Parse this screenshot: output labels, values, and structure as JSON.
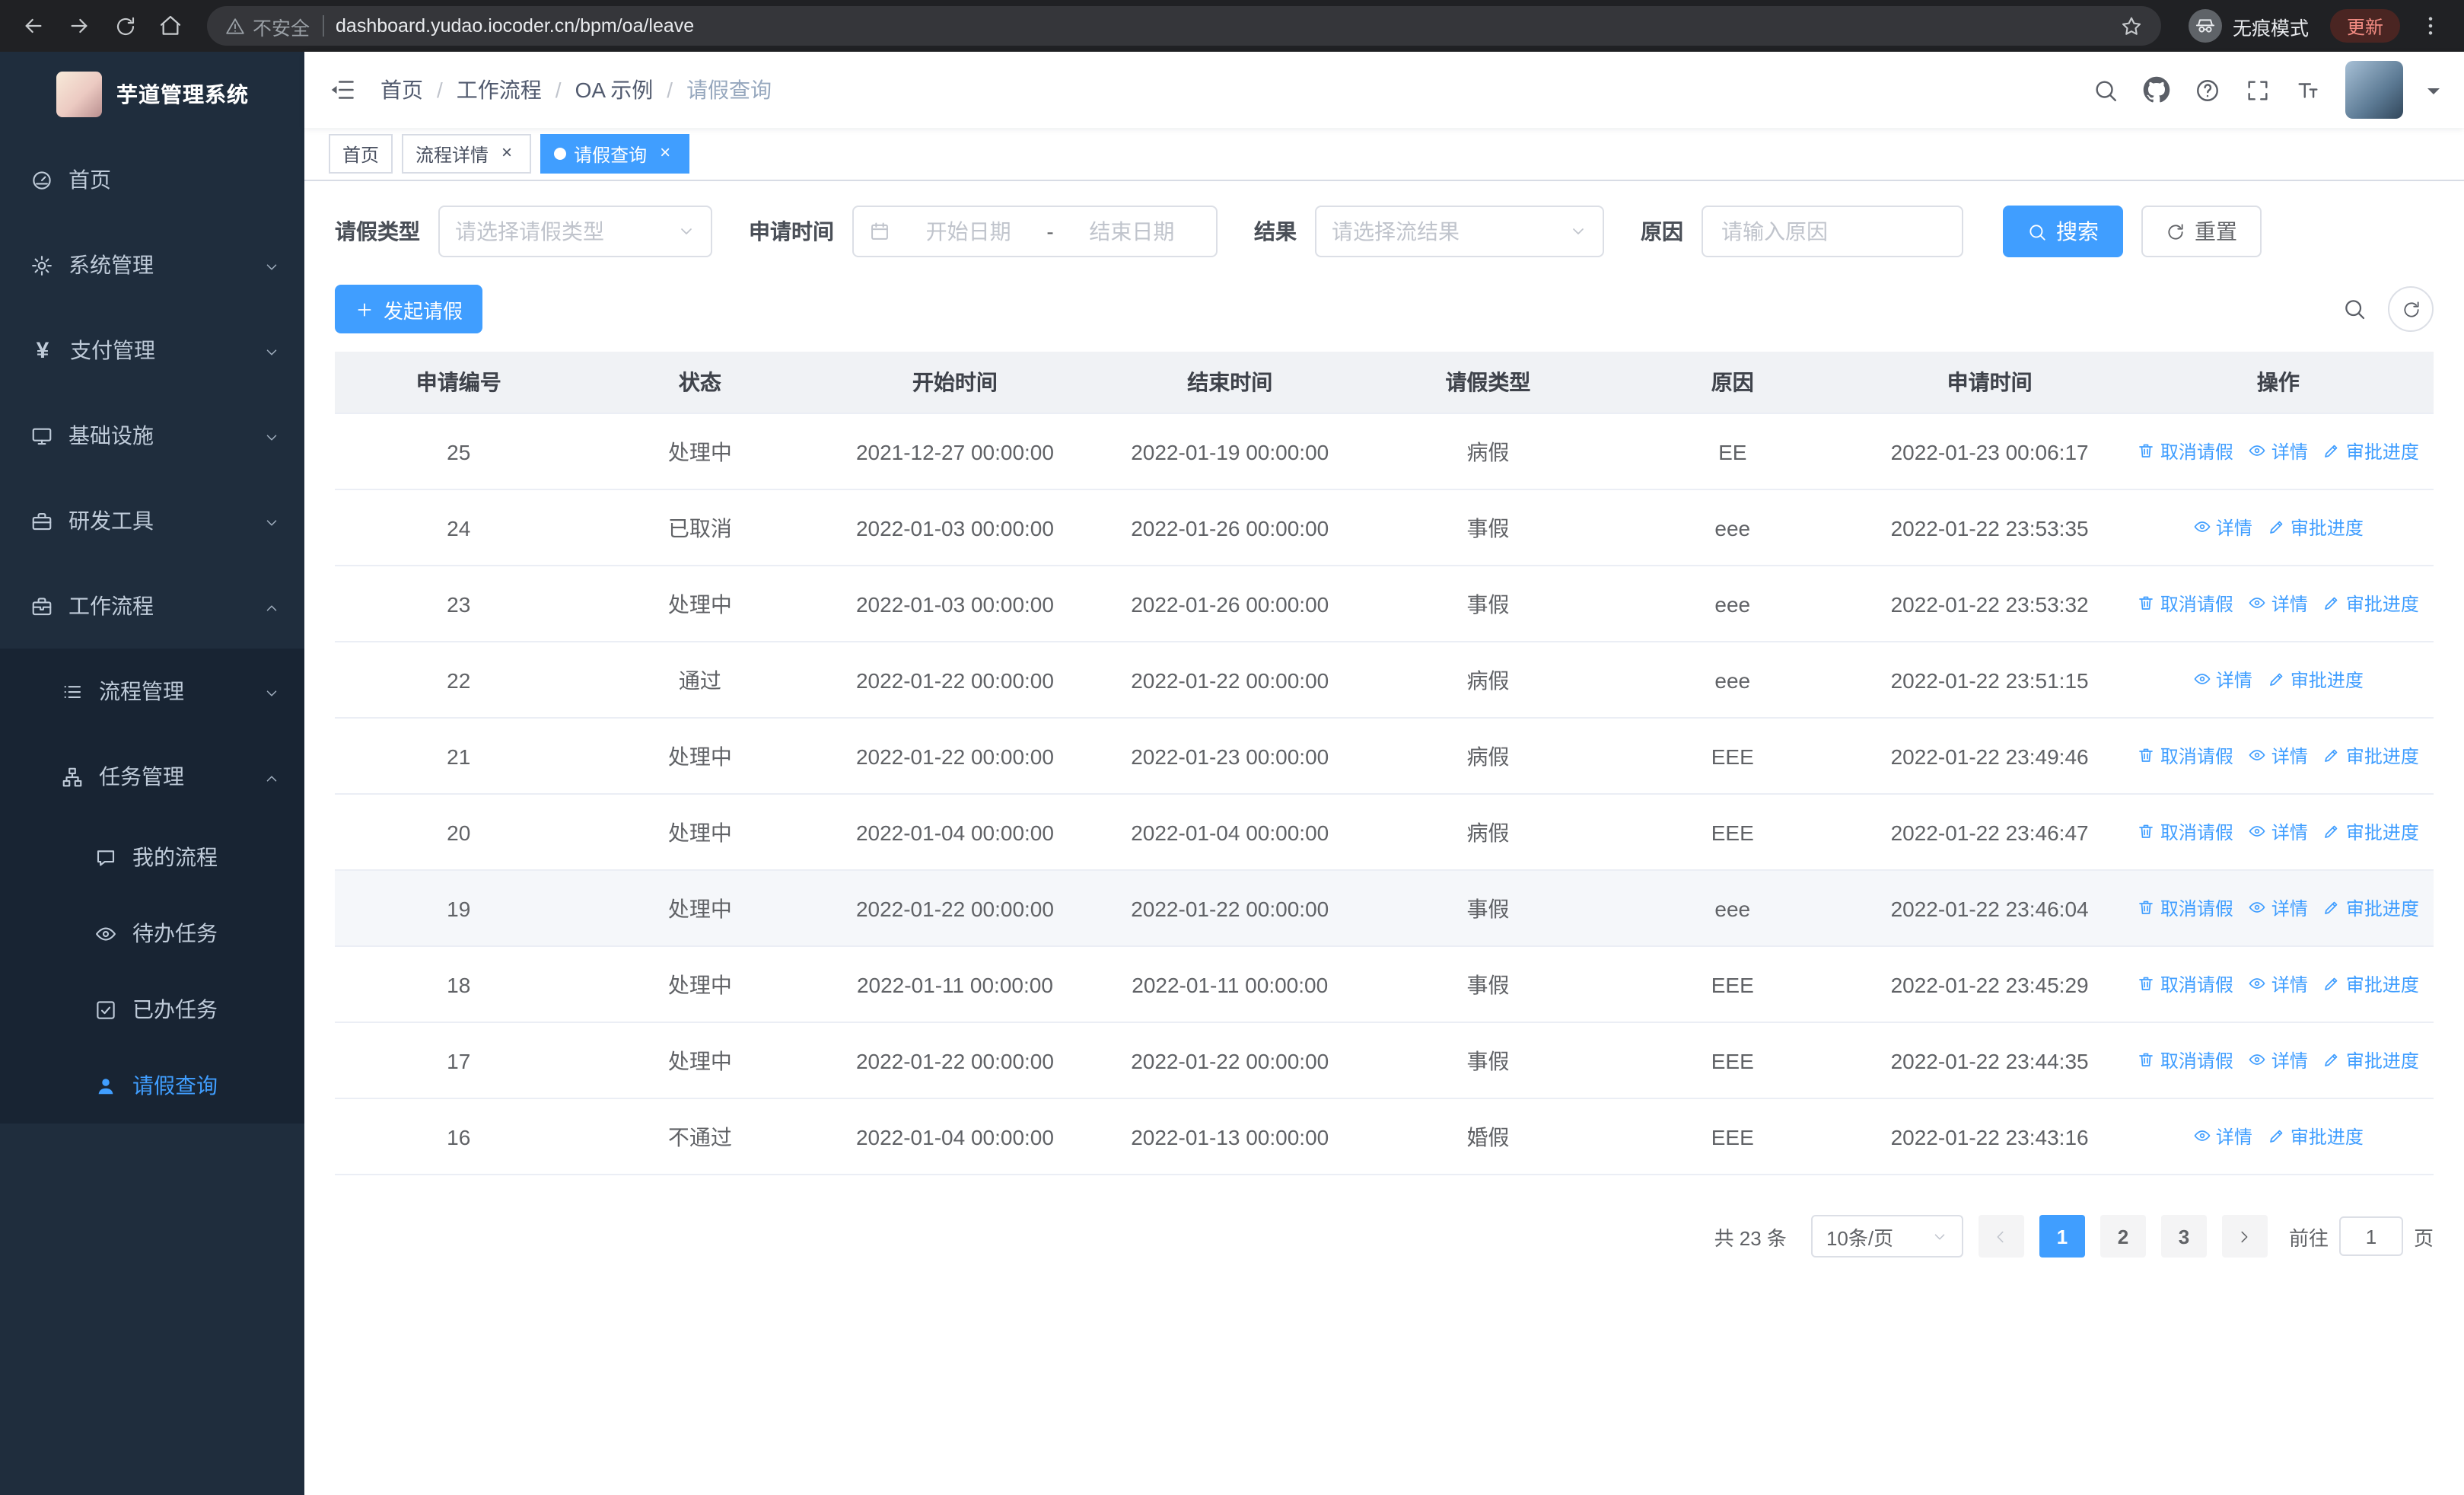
{
  "colors": {
    "primary": "#409eff",
    "sidebar_bg": "#1f2d3d",
    "table_header_bg": "#f0f2f5"
  },
  "browser": {
    "security_label": "不安全",
    "url": "dashboard.yudao.iocoder.cn/bpm/oa/leave",
    "incognito_label": "无痕模式",
    "update_label": "更新"
  },
  "sidebar": {
    "title": "芋道管理系统",
    "items": [
      {
        "name": "home",
        "icon": "dashboard-icon",
        "label": "首页",
        "level": 1
      },
      {
        "name": "system",
        "icon": "gear-icon",
        "label": "系统管理",
        "level": 1,
        "chevron": "down"
      },
      {
        "name": "payment",
        "icon": "yen-icon",
        "label": "支付管理",
        "level": 1,
        "chevron": "down"
      },
      {
        "name": "infra",
        "icon": "monitor-icon",
        "label": "基础设施",
        "level": 1,
        "chevron": "down"
      },
      {
        "name": "devtools",
        "icon": "toolbox-icon",
        "label": "研发工具",
        "level": 1,
        "chevron": "down"
      },
      {
        "name": "workflow",
        "icon": "briefcase-icon",
        "label": "工作流程",
        "level": 1,
        "chevron": "up",
        "open": true
      },
      {
        "name": "process-mgmt",
        "icon": "list-icon",
        "label": "流程管理",
        "level": 2,
        "chevron": "down"
      },
      {
        "name": "task-mgmt",
        "icon": "tree-icon",
        "label": "任务管理",
        "level": 2,
        "chevron": "up",
        "open": true
      },
      {
        "name": "my-process",
        "icon": "chat-icon",
        "label": "我的流程",
        "level": 3
      },
      {
        "name": "todo-tasks",
        "icon": "eye-icon",
        "label": "待办任务",
        "level": 3
      },
      {
        "name": "done-tasks",
        "icon": "check-square-icon",
        "label": "已办任务",
        "level": 3
      },
      {
        "name": "leave-query",
        "icon": "user-icon",
        "label": "请假查询",
        "level": 3,
        "active": true
      }
    ]
  },
  "header": {
    "breadcrumb": [
      "首页",
      "工作流程",
      "OA 示例",
      "请假查询"
    ],
    "breadcrumb_separator": "/"
  },
  "tabs": [
    {
      "label": "首页"
    },
    {
      "label": "流程详情",
      "closable": true
    },
    {
      "label": "请假查询",
      "closable": true,
      "active": true
    }
  ],
  "filters": {
    "leave_type_label": "请假类型",
    "leave_type_placeholder": "请选择请假类型",
    "apply_time_label": "申请时间",
    "start_placeholder": "开始日期",
    "range_separator": "-",
    "end_placeholder": "结束日期",
    "result_label": "结果",
    "result_placeholder": "请选择流结果",
    "reason_label": "原因",
    "reason_placeholder": "请输入原因",
    "search_label": "搜索",
    "reset_label": "重置"
  },
  "toolbar": {
    "create_label": "发起请假"
  },
  "table": {
    "columns": [
      "申请编号",
      "状态",
      "开始时间",
      "结束时间",
      "请假类型",
      "原因",
      "申请时间",
      "操作"
    ],
    "action_labels": {
      "cancel": "取消请假",
      "detail": "详情",
      "progress": "审批进度"
    },
    "rows": [
      {
        "id": "25",
        "status": "处理中",
        "start": "2021-12-27 00:00:00",
        "end": "2022-01-19 00:00:00",
        "type": "病假",
        "reason": "EE",
        "apply_time": "2022-01-23 00:06:17",
        "actions": [
          "cancel",
          "detail",
          "progress"
        ]
      },
      {
        "id": "24",
        "status": "已取消",
        "start": "2022-01-03 00:00:00",
        "end": "2022-01-26 00:00:00",
        "type": "事假",
        "reason": "eee",
        "apply_time": "2022-01-22 23:53:35",
        "actions": [
          "detail",
          "progress"
        ]
      },
      {
        "id": "23",
        "status": "处理中",
        "start": "2022-01-03 00:00:00",
        "end": "2022-01-26 00:00:00",
        "type": "事假",
        "reason": "eee",
        "apply_time": "2022-01-22 23:53:32",
        "actions": [
          "cancel",
          "detail",
          "progress"
        ]
      },
      {
        "id": "22",
        "status": "通过",
        "start": "2022-01-22 00:00:00",
        "end": "2022-01-22 00:00:00",
        "type": "病假",
        "reason": "eee",
        "apply_time": "2022-01-22 23:51:15",
        "actions": [
          "detail",
          "progress"
        ]
      },
      {
        "id": "21",
        "status": "处理中",
        "start": "2022-01-22 00:00:00",
        "end": "2022-01-23 00:00:00",
        "type": "病假",
        "reason": "EEE",
        "apply_time": "2022-01-22 23:49:46",
        "actions": [
          "cancel",
          "detail",
          "progress"
        ]
      },
      {
        "id": "20",
        "status": "处理中",
        "start": "2022-01-04 00:00:00",
        "end": "2022-01-04 00:00:00",
        "type": "病假",
        "reason": "EEE",
        "apply_time": "2022-01-22 23:46:47",
        "actions": [
          "cancel",
          "detail",
          "progress"
        ]
      },
      {
        "id": "19",
        "status": "处理中",
        "start": "2022-01-22 00:00:00",
        "end": "2022-01-22 00:00:00",
        "type": "事假",
        "reason": "eee",
        "apply_time": "2022-01-22 23:46:04",
        "actions": [
          "cancel",
          "detail",
          "progress"
        ],
        "highlighted": true
      },
      {
        "id": "18",
        "status": "处理中",
        "start": "2022-01-11 00:00:00",
        "end": "2022-01-11 00:00:00",
        "type": "事假",
        "reason": "EEE",
        "apply_time": "2022-01-22 23:45:29",
        "actions": [
          "cancel",
          "detail",
          "progress"
        ]
      },
      {
        "id": "17",
        "status": "处理中",
        "start": "2022-01-22 00:00:00",
        "end": "2022-01-22 00:00:00",
        "type": "事假",
        "reason": "EEE",
        "apply_time": "2022-01-22 23:44:35",
        "actions": [
          "cancel",
          "detail",
          "progress"
        ]
      },
      {
        "id": "16",
        "status": "不通过",
        "start": "2022-01-04 00:00:00",
        "end": "2022-01-13 00:00:00",
        "type": "婚假",
        "reason": "EEE",
        "apply_time": "2022-01-22 23:43:16",
        "actions": [
          "detail",
          "progress"
        ]
      }
    ]
  },
  "pagination": {
    "total_label": "共 23 条",
    "page_size": "10条/页",
    "pages": [
      "1",
      "2",
      "3"
    ],
    "active_page": "1",
    "goto_label": "前往",
    "goto_value": "1",
    "page_unit": "页"
  }
}
